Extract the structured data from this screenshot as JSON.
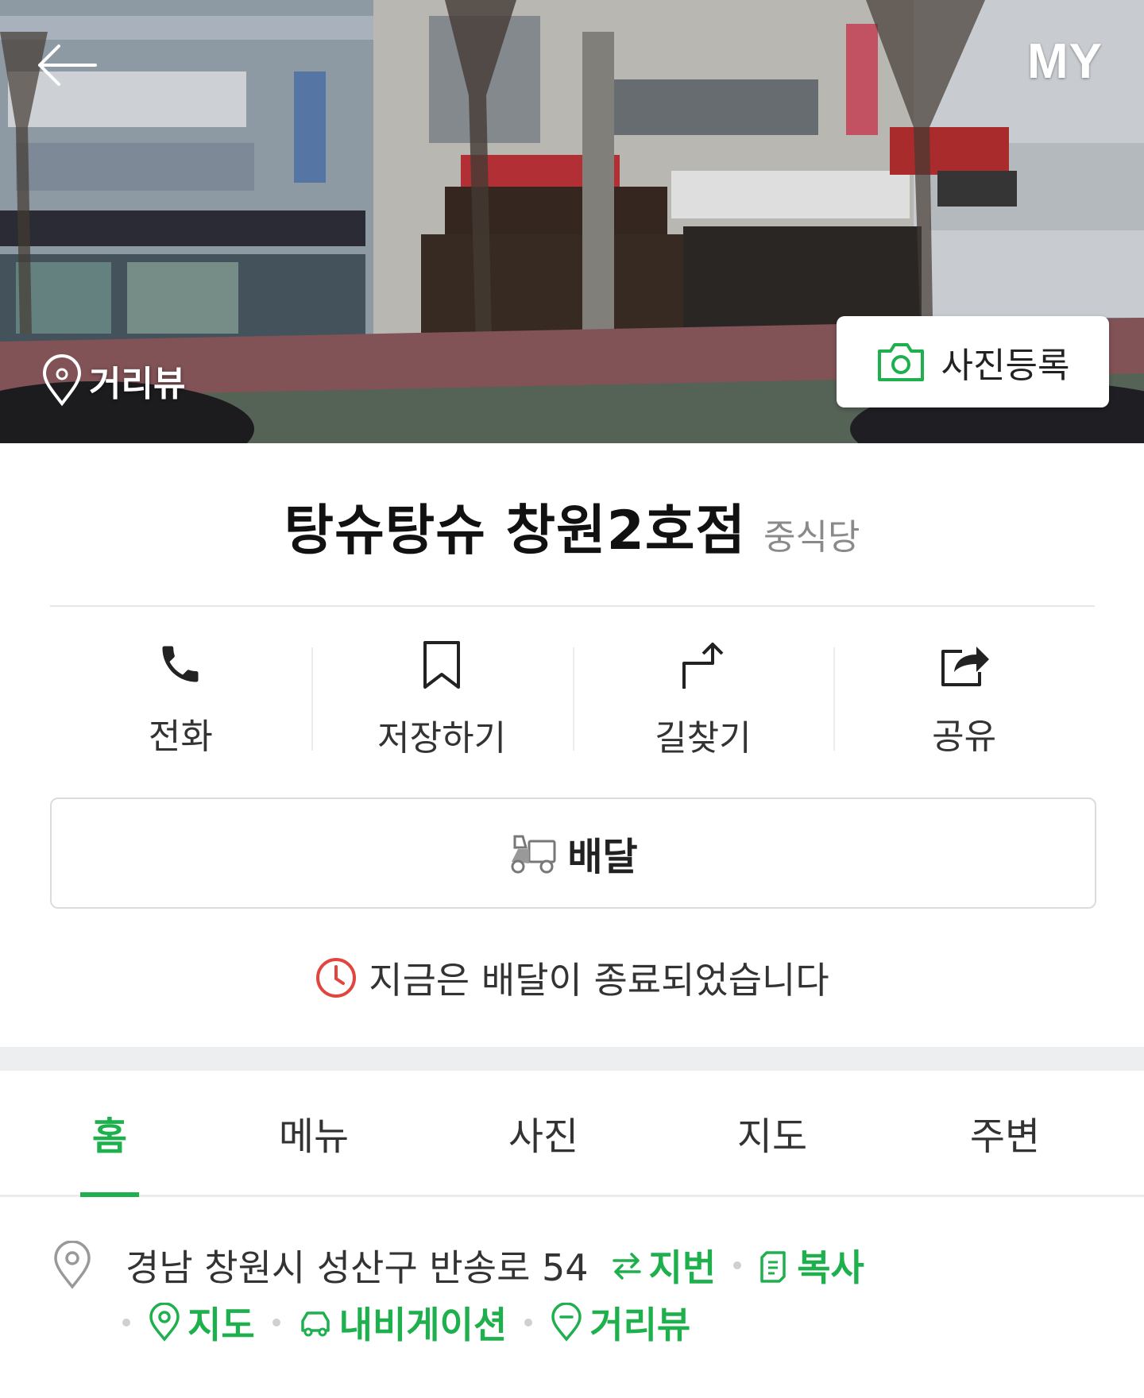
{
  "header": {
    "my_label": "MY",
    "streetview_label": "거리뷰",
    "photo_register_label": "사진등록"
  },
  "place": {
    "name": "탕슈탕슈 창원2호점",
    "category": "중식당"
  },
  "actions": [
    {
      "label": "전화",
      "icon": "phone-icon"
    },
    {
      "label": "저장하기",
      "icon": "bookmark-icon"
    },
    {
      "label": "길찾기",
      "icon": "directions-icon"
    },
    {
      "label": "공유",
      "icon": "share-icon"
    }
  ],
  "delivery": {
    "button_label": "배달",
    "notice": "지금은 배달이 종료되었습니다"
  },
  "tabs": [
    "홈",
    "메뉴",
    "사진",
    "지도",
    "주변"
  ],
  "address": {
    "text": "경남 창원시 성산구 반송로 54",
    "lot_label": "지번",
    "copy_label": "복사",
    "map_label": "지도",
    "navigation_label": "내비게이션",
    "streetview_label": "거리뷰"
  },
  "colors": {
    "accent": "#1fb04e",
    "alert": "#e0463e"
  }
}
